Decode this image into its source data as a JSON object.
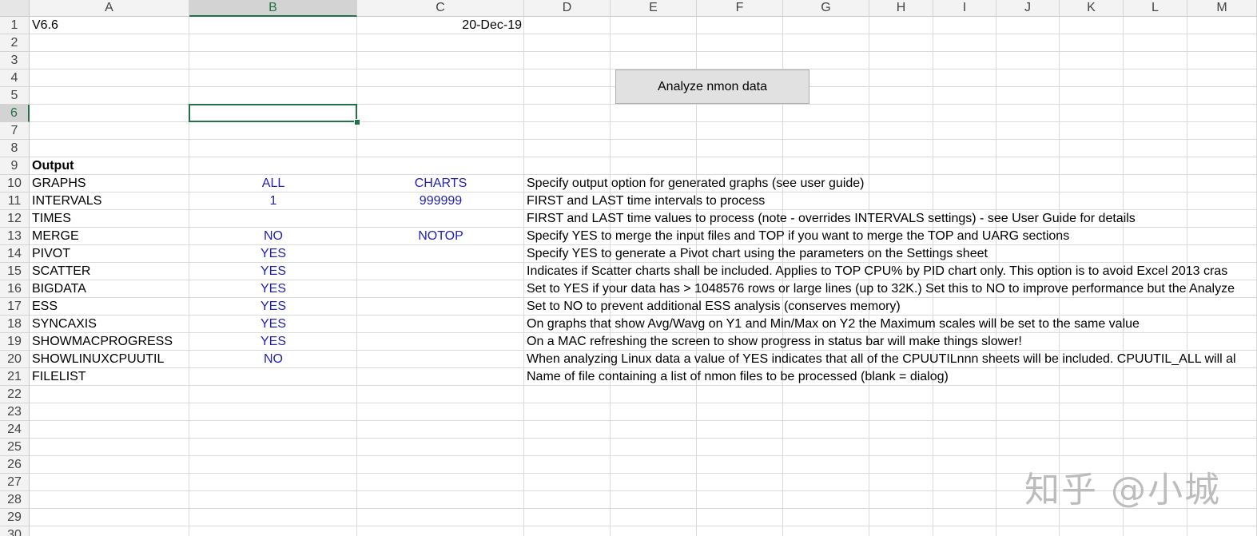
{
  "columns": [
    "A",
    "B",
    "C",
    "D",
    "E",
    "F",
    "G",
    "H",
    "I",
    "J",
    "K",
    "L",
    "M"
  ],
  "selected_column": "B",
  "selected_row": 6,
  "row_count": 30,
  "button": {
    "label": "Analyze nmon data"
  },
  "watermark": "知乎 @小城",
  "cells": [
    {
      "row": 1,
      "col": "A",
      "text": "V6.6"
    },
    {
      "row": 1,
      "col": "C",
      "text": "20-Dec-19",
      "align": "right"
    },
    {
      "row": 9,
      "col": "A",
      "text": "Output",
      "bold": true
    },
    {
      "row": 10,
      "col": "A",
      "text": "GRAPHS"
    },
    {
      "row": 10,
      "col": "B",
      "text": "ALL",
      "align": "center",
      "blue": true
    },
    {
      "row": 10,
      "col": "C",
      "text": "CHARTS",
      "align": "center",
      "blue": true
    },
    {
      "row": 10,
      "col": "D",
      "text": "Specify output option for generated graphs (see user guide)"
    },
    {
      "row": 11,
      "col": "A",
      "text": "INTERVALS"
    },
    {
      "row": 11,
      "col": "B",
      "text": "1",
      "align": "center",
      "blue": true
    },
    {
      "row": 11,
      "col": "C",
      "text": "999999",
      "align": "center",
      "blue": true
    },
    {
      "row": 11,
      "col": "D",
      "text": "FIRST and LAST time intervals to process"
    },
    {
      "row": 12,
      "col": "A",
      "text": "TIMES"
    },
    {
      "row": 12,
      "col": "D",
      "text": "FIRST and LAST time values to process (note - overrides INTERVALS settings) - see User Guide for details"
    },
    {
      "row": 13,
      "col": "A",
      "text": "MERGE"
    },
    {
      "row": 13,
      "col": "B",
      "text": "NO",
      "align": "center",
      "blue": true
    },
    {
      "row": 13,
      "col": "C",
      "text": "NOTOP",
      "align": "center",
      "blue": true
    },
    {
      "row": 13,
      "col": "D",
      "text": "Specify YES to merge the input files and TOP if you want to merge the TOP and UARG sections"
    },
    {
      "row": 14,
      "col": "A",
      "text": "PIVOT"
    },
    {
      "row": 14,
      "col": "B",
      "text": "YES",
      "align": "center",
      "blue": true
    },
    {
      "row": 14,
      "col": "D",
      "text": "Specify YES to generate a Pivot chart using the parameters on the Settings sheet"
    },
    {
      "row": 15,
      "col": "A",
      "text": "SCATTER"
    },
    {
      "row": 15,
      "col": "B",
      "text": "YES",
      "align": "center",
      "blue": true
    },
    {
      "row": 15,
      "col": "D",
      "text": "Indicates if Scatter charts shall be included.  Applies to TOP CPU% by PID chart only.  This option is to avoid Excel 2013 cras"
    },
    {
      "row": 16,
      "col": "A",
      "text": "BIGDATA"
    },
    {
      "row": 16,
      "col": "B",
      "text": "YES",
      "align": "center",
      "blue": true
    },
    {
      "row": 16,
      "col": "D",
      "text": "Set to YES if your data has > 1048576 rows or large lines (up to 32K.)  Set this to NO to improve performance but the Analyze"
    },
    {
      "row": 17,
      "col": "A",
      "text": "ESS"
    },
    {
      "row": 17,
      "col": "B",
      "text": "YES",
      "align": "center",
      "blue": true
    },
    {
      "row": 17,
      "col": "D",
      "text": "Set to NO to prevent additional ESS analysis (conserves memory)"
    },
    {
      "row": 18,
      "col": "A",
      "text": "SYNCAXIS"
    },
    {
      "row": 18,
      "col": "B",
      "text": "YES",
      "align": "center",
      "blue": true
    },
    {
      "row": 18,
      "col": "D",
      "text": "On graphs that show Avg/Wavg on Y1 and Min/Max on Y2 the Maximum scales will be set to the same value"
    },
    {
      "row": 19,
      "col": "A",
      "text": "SHOWMACPROGRESS"
    },
    {
      "row": 19,
      "col": "B",
      "text": "YES",
      "align": "center",
      "blue": true
    },
    {
      "row": 19,
      "col": "D",
      "text": "On a MAC refreshing the screen to show progress in status bar will make things slower!"
    },
    {
      "row": 20,
      "col": "A",
      "text": "SHOWLINUXCPUUTIL"
    },
    {
      "row": 20,
      "col": "B",
      "text": "NO",
      "align": "center",
      "blue": true
    },
    {
      "row": 20,
      "col": "D",
      "text": "When analyzing Linux data a value of YES indicates that all of the CPUUTILnnn sheets will be included.  CPUUTIL_ALL will al"
    },
    {
      "row": 21,
      "col": "A",
      "text": "FILELIST"
    },
    {
      "row": 21,
      "col": "D",
      "text": "Name of file containing a list of nmon files to be processed (blank = dialog)"
    }
  ]
}
